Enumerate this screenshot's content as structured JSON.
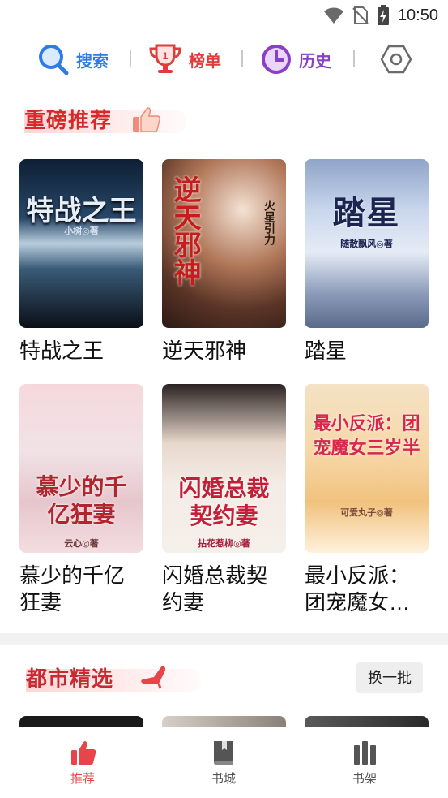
{
  "status_bar": {
    "time": "10:50"
  },
  "top_nav": {
    "items": [
      {
        "label": "搜索",
        "icon": "search-icon",
        "color": "#2f7be6"
      },
      {
        "label": "榜单",
        "icon": "trophy-icon",
        "color": "#e23b3b"
      },
      {
        "label": "历史",
        "icon": "clock-icon",
        "color": "#8a3fc7"
      }
    ],
    "settings_icon": "settings-hexagon-icon"
  },
  "featured": {
    "title": "重磅推荐",
    "books": [
      {
        "title": "特战之王",
        "cover_text": "特战之王",
        "cover_author": "小树◎著"
      },
      {
        "title": "逆天邪神",
        "cover_text": "逆天邪神",
        "cover_author": "火星引力"
      },
      {
        "title": "踏星",
        "cover_text": "踏星",
        "cover_author": "随散飘风◎著"
      },
      {
        "title": "慕少的千亿狂妻",
        "cover_text": "慕少的千亿狂妻",
        "cover_author": "云心◎著"
      },
      {
        "title": "闪婚总裁契约妻",
        "cover_text": "闪婚总裁契约妻",
        "cover_author": "拈花惹柳◎著"
      },
      {
        "title": "最小反派：团宠魔女三岁半",
        "cover_text": "最小反派：团宠魔女三岁半",
        "cover_author": "可爱丸子◎著"
      }
    ]
  },
  "urban": {
    "title": "都市精选",
    "refresh_label": "换一批"
  },
  "tab_bar": {
    "tabs": [
      {
        "label": "推荐",
        "icon": "thumbs-up-icon",
        "active": true
      },
      {
        "label": "书城",
        "icon": "book-icon",
        "active": false
      },
      {
        "label": "书架",
        "icon": "bookshelf-icon",
        "active": false
      }
    ],
    "active_color": "#e8454a",
    "inactive_color": "#555555"
  }
}
